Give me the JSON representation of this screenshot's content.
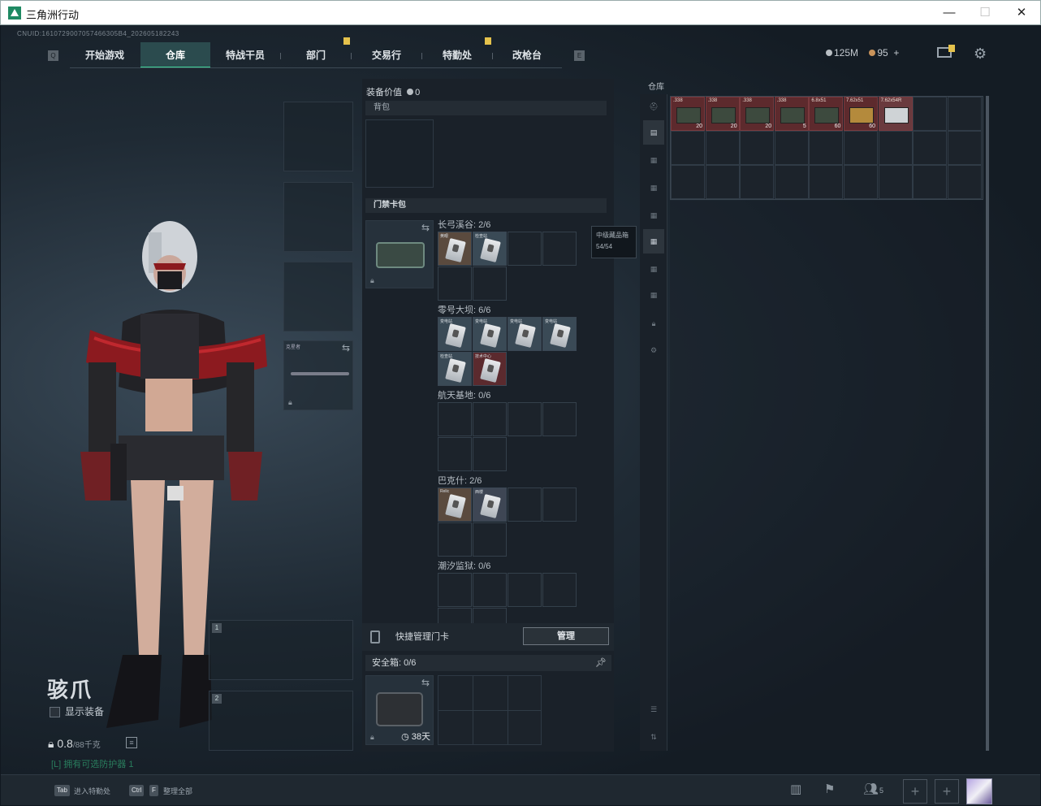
{
  "window": {
    "title": "三角洲行动"
  },
  "uid": "CNUID:1610729007057466305B4_202605182243",
  "nav": {
    "tabs": [
      {
        "label": "开始游戏"
      },
      {
        "label": "仓库"
      },
      {
        "label": "特战干员"
      },
      {
        "label": "部门"
      },
      {
        "label": "交易行"
      },
      {
        "label": "特勤处"
      },
      {
        "label": "改枪台"
      }
    ],
    "left_key": "Q",
    "right_key": "E"
  },
  "currency": {
    "silver": "125M",
    "gold": "95",
    "plus": "+"
  },
  "character": {
    "name": "骇爪",
    "show_equipment": "显示装备",
    "weight": "0.8",
    "weight_unit": "/88千克",
    "hint": "[L] 拥有可选防护器 1"
  },
  "equipment": {
    "melee_label": "克星者",
    "weapon_slot_1": "1",
    "weapon_slot_2": "2"
  },
  "midpanel": {
    "equip_value_label": "装备价值",
    "equip_value": "0",
    "backpack_label": "背包",
    "keycard_label": "门禁卡包",
    "keycard_sets": [
      {
        "title": "长弓溪谷: 2/6"
      },
      {
        "title": "零号大坝: 6/6"
      },
      {
        "title": "航天基地: 0/6"
      },
      {
        "title": "巴克什: 2/6"
      },
      {
        "title": "潮汐监狱: 0/6"
      }
    ],
    "card_labels": [
      "黄眼",
      "检查站",
      "变电站",
      "变电站",
      "变电站",
      "变电站",
      "检查站",
      "技术中心",
      "Relic",
      "西楼"
    ],
    "manage_label": "快捷管理门卡",
    "manage_button": "管理",
    "safebox_label": "安全箱: 0/6",
    "safebox_timer": "38天"
  },
  "tooltip": {
    "title": "中级藏品箱",
    "count": "54/54"
  },
  "warehouse": {
    "label": "仓库",
    "items": [
      {
        "label": ".338",
        "count": "20",
        "style": "dark"
      },
      {
        "label": ".338",
        "count": "20",
        "style": "dark"
      },
      {
        "label": ".338",
        "count": "20",
        "style": "dark"
      },
      {
        "label": ".338",
        "count": "5",
        "style": "dark"
      },
      {
        "label": "6.8x51",
        "count": "60",
        "style": "dark"
      },
      {
        "label": "7.62x51",
        "count": "60",
        "style": "gold"
      },
      {
        "label": "7.62x54R",
        "count": "",
        "style": "white"
      }
    ]
  },
  "bottombar": {
    "key1": "Tab",
    "key1_text": "进入特勤处",
    "key2a": "Ctrl",
    "key2b": "F",
    "key2_text": "整理全部",
    "party_count": "5"
  },
  "colors": {
    "accent": "#3fd69a",
    "badge": "#e5c24c",
    "item_red": "#5d2a2d"
  }
}
